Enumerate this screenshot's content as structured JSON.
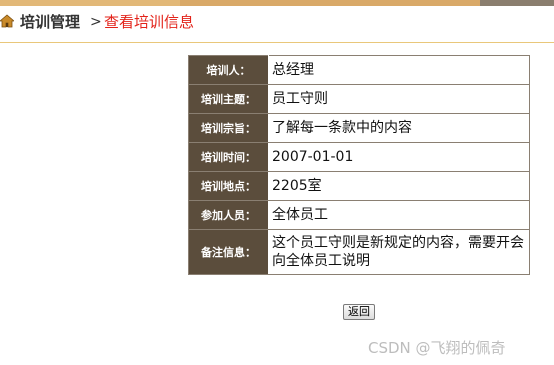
{
  "colors": {
    "label_bg": "#5b4d3c",
    "current_page": "#e3231a",
    "top_strip": "#d7a764"
  },
  "header": {
    "home_icon": "home-icon",
    "section": "培训管理",
    "separator": ">",
    "current_page": "查看培训信息"
  },
  "detail": {
    "rows": [
      {
        "label": "培训人：",
        "value": "总经理"
      },
      {
        "label": "培训主题：",
        "value": "员工守则"
      },
      {
        "label": "培训宗旨：",
        "value": "了解每一条款中的内容"
      },
      {
        "label": "培训时间：",
        "value": "2007-01-01"
      },
      {
        "label": "培训地点：",
        "value": "2205室"
      },
      {
        "label": "参加人员：",
        "value": "全体员工"
      },
      {
        "label": "备注信息：",
        "value": "这个员工守则是新规定的内容，需要开会向全体员工说明"
      }
    ]
  },
  "actions": {
    "return_label": "返回"
  },
  "watermark": "CSDN @飞翔的佩奇"
}
